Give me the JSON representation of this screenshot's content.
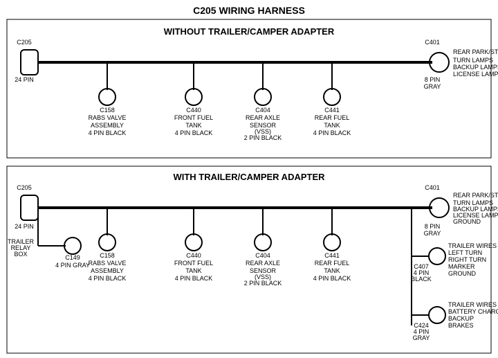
{
  "title": "C205 WIRING HARNESS",
  "section1": {
    "label": "WITHOUT TRAILER/CAMPER ADAPTER",
    "left_connector": {
      "name": "C205",
      "pins": "24 PIN"
    },
    "right_connector": {
      "name": "C401",
      "pins": "8 PIN",
      "color": "GRAY"
    },
    "right_labels": [
      "REAR PARK/STOP",
      "TURN LAMPS",
      "BACKUP LAMPS",
      "LICENSE LAMPS"
    ],
    "connectors": [
      {
        "name": "C158",
        "line1": "RABS VALVE",
        "line2": "ASSEMBLY",
        "line3": "4 PIN BLACK"
      },
      {
        "name": "C440",
        "line1": "FRONT FUEL",
        "line2": "TANK",
        "line3": "4 PIN BLACK"
      },
      {
        "name": "C404",
        "line1": "REAR AXLE",
        "line2": "SENSOR",
        "line3": "(VSS)",
        "line4": "2 PIN BLACK"
      },
      {
        "name": "C441",
        "line1": "REAR FUEL",
        "line2": "TANK",
        "line3": "4 PIN BLACK"
      }
    ]
  },
  "section2": {
    "label": "WITH TRAILER/CAMPER ADAPTER",
    "left_connector": {
      "name": "C205",
      "pins": "24 PIN"
    },
    "right_connector": {
      "name": "C401",
      "pins": "8 PIN",
      "color": "GRAY"
    },
    "right_labels": [
      "REAR PARK/STOP",
      "TURN LAMPS",
      "BACKUP LAMPS",
      "LICENSE LAMPS",
      "GROUND"
    ],
    "trailer_relay": {
      "name": "TRAILER",
      "line2": "RELAY",
      "line3": "BOX"
    },
    "c149": {
      "name": "C149",
      "pins": "4 PIN GRAY"
    },
    "connectors": [
      {
        "name": "C158",
        "line1": "RABS VALVE",
        "line2": "ASSEMBLY",
        "line3": "4 PIN BLACK"
      },
      {
        "name": "C440",
        "line1": "FRONT FUEL",
        "line2": "TANK",
        "line3": "4 PIN BLACK"
      },
      {
        "name": "C404",
        "line1": "REAR AXLE",
        "line2": "SENSOR",
        "line3": "(VSS)",
        "line4": "2 PIN BLACK"
      },
      {
        "name": "C441",
        "line1": "REAR FUEL",
        "line2": "TANK",
        "line3": "4 PIN BLACK"
      }
    ],
    "c407": {
      "name": "C407",
      "pins": "4 PIN",
      "color": "BLACK"
    },
    "c407_labels": [
      "TRAILER WIRES",
      "LEFT TURN",
      "RIGHT TURN",
      "MARKER",
      "GROUND"
    ],
    "c424": {
      "name": "C424",
      "pins": "4 PIN",
      "color": "GRAY"
    },
    "c424_labels": [
      "TRAILER WIRES",
      "BATTERY CHARGE",
      "BACKUP",
      "BRAKES"
    ]
  }
}
